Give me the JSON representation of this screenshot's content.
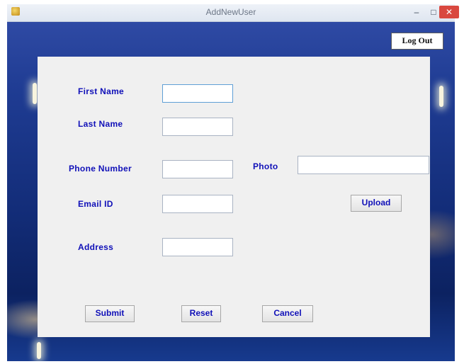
{
  "window": {
    "title": "AddNewUser",
    "minimize": "–",
    "maximize": "□",
    "close": "✕"
  },
  "toolbar": {
    "logout_label": "Log Out"
  },
  "form": {
    "first_name_label": "First Name",
    "last_name_label": "Last Name",
    "phone_label": "Phone Number",
    "email_label": "Email ID",
    "address_label": "Address",
    "photo_label": "Photo",
    "first_name_value": "",
    "last_name_value": "",
    "phone_value": "",
    "email_value": "",
    "address_value": "",
    "photo_value": ""
  },
  "buttons": {
    "upload": "Upload",
    "submit": "Submit",
    "reset": "Reset",
    "cancel": "Cancel"
  },
  "colors": {
    "label_text": "#1010b8",
    "panel": "#f0f0f0",
    "close_button": "#d9483f"
  }
}
